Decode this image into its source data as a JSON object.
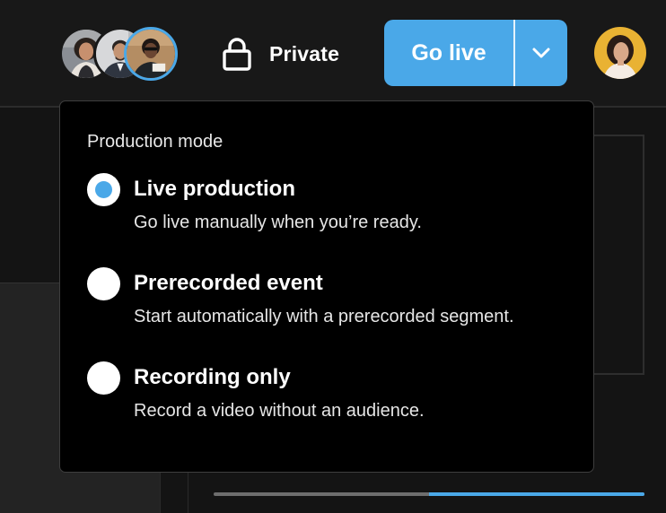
{
  "header": {
    "participants": [
      {
        "name": "participant-1",
        "ring_color": "#181818"
      },
      {
        "name": "participant-2",
        "ring_color": "#181818"
      },
      {
        "name": "participant-3",
        "ring_color": "#4aa8e8"
      }
    ],
    "privacy": {
      "label": "Private",
      "icon": "lock-icon"
    },
    "go_live": {
      "label": "Go live",
      "toggle_icon": "chevron-down-icon",
      "color": "#4aa8e8"
    },
    "user_avatar": "user-avatar"
  },
  "dropdown": {
    "title": "Production mode",
    "options": [
      {
        "title": "Live production",
        "description": "Go live manually when you’re ready.",
        "selected": true
      },
      {
        "title": "Prerecorded event",
        "description": "Start automatically with a prerecorded segment.",
        "selected": false
      },
      {
        "title": "Recording only",
        "description": "Record a video without an audience.",
        "selected": false
      }
    ]
  },
  "progress": {
    "filled_fraction": 0.5,
    "fill_color": "#4aa8e8"
  },
  "colors": {
    "accent": "#4aa8e8",
    "background": "#181818",
    "panel": "#000000"
  }
}
